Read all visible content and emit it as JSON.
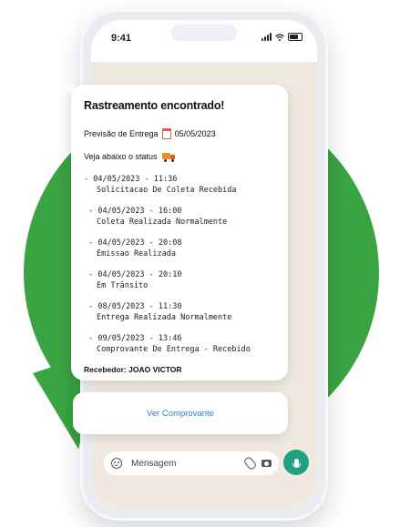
{
  "colors": {
    "brand_green": "#3aa443",
    "mic_green": "#1fa284",
    "link_blue": "#2f80d6"
  },
  "status_bar": {
    "time": "9:41"
  },
  "message": {
    "title": "Rastreamento encontrado!",
    "forecast_label": "Previsão de Entrega",
    "forecast_icon": "calendar-icon",
    "forecast_date": "05/05/2023",
    "status_intro": "Veja abaixo o status",
    "status_icon": "delivery-truck-icon",
    "events": [
      {
        "date": "- 04/05/2023 - 11:36",
        "description": "Solicitacao De Coleta Recebida"
      },
      {
        "date": " - 04/05/2023 - 16:00",
        "description": "Coleta Realizada Normalmente"
      },
      {
        "date": " - 04/05/2023 - 20:08",
        "description": "Emissao Realizada"
      },
      {
        "date": " - 04/05/2023 - 20:10",
        "description": "Em Trânsito"
      },
      {
        "date": " - 08/05/2023 - 11:30",
        "description": "Entrega Realizada Normalmente"
      },
      {
        "date": " - 09/05/2023 - 13:46",
        "description": "Comprovante De Entrega - Recebido"
      }
    ],
    "receiver": "Recebedor: JOAO VICTOR"
  },
  "action": {
    "button_label": "Ver Comprovante"
  },
  "composer": {
    "placeholder": "Mensagem",
    "icons": [
      "emoji-icon",
      "paperclip-icon",
      "camera-icon",
      "microphone-icon"
    ]
  }
}
